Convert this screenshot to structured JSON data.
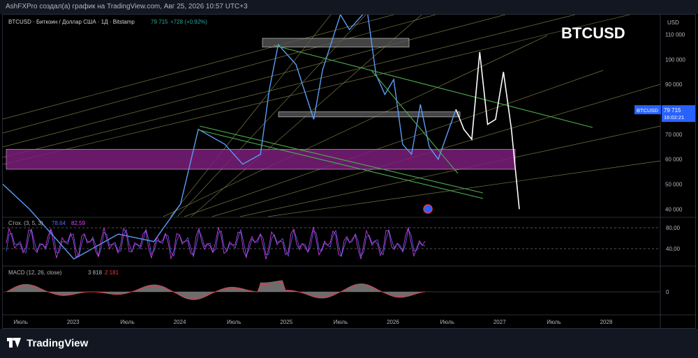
{
  "header": {
    "publisher_text": "AshFXPro создал(а) график на TradingView.com, Авг 25, 2026 10:57 UTC+3"
  },
  "legend": {
    "symbol": "BTCUSD · Биткоин / Доллар США · 1Д · Bitstamp",
    "last": "79 715",
    "change": "+728 (+0,92%)"
  },
  "watermark": "BTCUSD",
  "price_scale": {
    "currency": "USD",
    "ticks": [
      "110 000",
      "100 000",
      "90 000",
      "80 000",
      "70 000",
      "60 000",
      "50 000",
      "40 000"
    ],
    "last_label": "BTCUSD",
    "last_value": "79 715",
    "countdown": "16:02:21"
  },
  "stoch": {
    "label": "Стох. (3, 5, 3)",
    "k": "78,64",
    "d": "82,59",
    "ticks": [
      "80,00",
      "40,00"
    ]
  },
  "macd": {
    "label": "MACD (12, 26, close)",
    "v1": "3 818",
    "v2": "2 181",
    "ticks": [
      "0"
    ]
  },
  "time_axis": [
    "Июль",
    "2023",
    "Июль",
    "2024",
    "Июль",
    "2025",
    "Июль",
    "2026",
    "Июль",
    "2027",
    "Июль",
    "2028"
  ],
  "footer": {
    "brand": "TradingView"
  },
  "colors": {
    "price_line": "#5b9cf6",
    "zone": "#7b1f7b",
    "trend_green": "#4caf50",
    "fib_lines": "#9e9d5a",
    "stoch_k": "#e040fb",
    "stoch_d": "#5b6af6",
    "macd_pos": "#888888",
    "macd_signal": "#f23645",
    "up": "#26a69a",
    "down": "#f23645"
  },
  "chart_data": {
    "type": "line",
    "title": "BTCUSD",
    "ylabel": "USD",
    "ylim": [
      37000,
      118000
    ],
    "x_range": [
      "2022-05",
      "2028-07"
    ],
    "series": [
      {
        "name": "BTCUSD",
        "x": [
          "2022-05",
          "2022-08",
          "2023-01",
          "2023-06",
          "2023-10",
          "2024-01",
          "2024-03",
          "2024-06",
          "2024-08",
          "2024-10",
          "2024-11",
          "2024-12",
          "2025-02",
          "2025-04",
          "2025-05",
          "2025-07",
          "2025-08",
          "2025-10",
          "2025-11",
          "2025-12",
          "2026-01",
          "2026-02",
          "2026-03",
          "2026-04",
          "2026-05",
          "2026-06",
          "2026-08"
        ],
        "values": [
          50000,
          40000,
          20000,
          30000,
          27000,
          42000,
          72000,
          66000,
          58000,
          62000,
          88000,
          106000,
          98000,
          76000,
          96000,
          118000,
          112000,
          120000,
          94000,
          86000,
          92000,
          66000,
          62000,
          82000,
          65000,
          60000,
          80000
        ]
      }
    ],
    "projection": [
      80000,
      72000,
      68000,
      103000,
      74000,
      76000,
      95000,
      72000,
      40000
    ],
    "zones": [
      {
        "y_from": 56000,
        "y_to": 64000
      },
      {
        "y_from": 105000,
        "y_to": 108500
      },
      {
        "y_from": 77000,
        "y_to": 79000
      }
    ]
  }
}
